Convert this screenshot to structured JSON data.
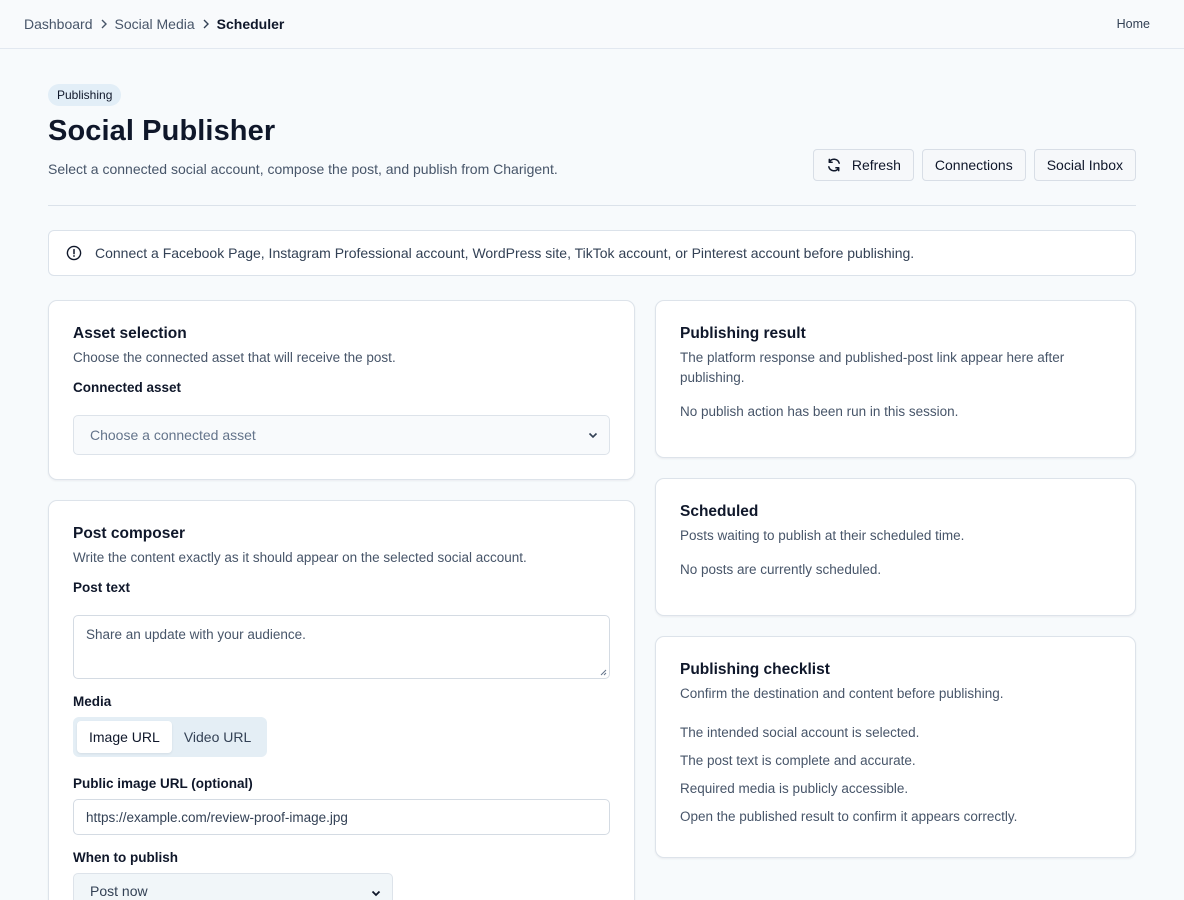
{
  "breadcrumb": {
    "items": [
      "Dashboard",
      "Social Media"
    ],
    "current": "Scheduler"
  },
  "topbar": {
    "home_label": "Home"
  },
  "header": {
    "badge": "Publishing",
    "title": "Social Publisher",
    "subtitle": "Select a connected social account, compose the post, and publish from Charigent."
  },
  "actions": {
    "refresh": "Refresh",
    "connections": "Connections",
    "inbox": "Social Inbox"
  },
  "alert": {
    "text": "Connect a Facebook Page, Instagram Professional account, WordPress site, TikTok account, or Pinterest account before publishing."
  },
  "asset_card": {
    "title": "Asset selection",
    "description": "Choose the connected asset that will receive the post.",
    "field_label": "Connected asset",
    "placeholder": "Choose a connected asset"
  },
  "composer": {
    "title": "Post composer",
    "description": "Write the content exactly as it should appear on the selected social account.",
    "post_text_label": "Post text",
    "post_text_placeholder": "Share an update with your audience.",
    "media_label": "Media",
    "media_options": [
      "Image URL",
      "Video URL"
    ],
    "media_selected": "Image URL",
    "image_url_label": "Public image URL (optional)",
    "image_url_value": "https://example.com/review-proof-image.jpg",
    "when_label": "When to publish",
    "when_value": "Post now"
  },
  "result_card": {
    "title": "Publishing result",
    "description": "The platform response and published-post link appear here after publishing.",
    "empty": "No publish action has been run in this session."
  },
  "scheduled_card": {
    "title": "Scheduled",
    "description": "Posts waiting to publish at their scheduled time.",
    "empty": "No posts are currently scheduled."
  },
  "checklist_card": {
    "title": "Publishing checklist",
    "description": "Confirm the destination and content before publishing.",
    "items": [
      "The intended social account is selected.",
      "The post text is complete and accurate.",
      "Required media is publicly accessible.",
      "Open the published result to confirm it appears correctly."
    ]
  }
}
